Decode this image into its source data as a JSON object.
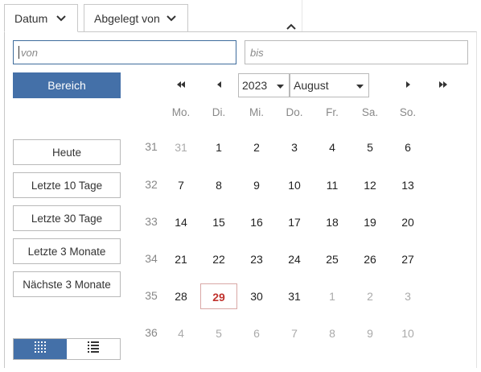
{
  "tabs": {
    "datum": "Datum",
    "abgelegt": "Abgelegt von"
  },
  "range": {
    "from_placeholder": "von",
    "to_placeholder": "bis"
  },
  "range_button": "Bereich",
  "quick": [
    "Heute",
    "Letzte 10 Tage",
    "Letzte 30 Tage",
    "Letzte 3 Monate",
    "Nächste 3 Monate"
  ],
  "calendar": {
    "year": "2023",
    "month": "August",
    "weekdays": [
      "Mo.",
      "Di.",
      "Mi.",
      "Do.",
      "Fr.",
      "Sa.",
      "So."
    ],
    "today": "29",
    "weeks": [
      {
        "kw": "31",
        "days": [
          [
            "31",
            true
          ],
          [
            "1",
            false
          ],
          [
            "2",
            false
          ],
          [
            "3",
            false
          ],
          [
            "4",
            false
          ],
          [
            "5",
            false
          ],
          [
            "6",
            false
          ]
        ]
      },
      {
        "kw": "32",
        "days": [
          [
            "7",
            false
          ],
          [
            "8",
            false
          ],
          [
            "9",
            false
          ],
          [
            "10",
            false
          ],
          [
            "11",
            false
          ],
          [
            "12",
            false
          ],
          [
            "13",
            false
          ]
        ]
      },
      {
        "kw": "33",
        "days": [
          [
            "14",
            false
          ],
          [
            "15",
            false
          ],
          [
            "16",
            false
          ],
          [
            "17",
            false
          ],
          [
            "18",
            false
          ],
          [
            "19",
            false
          ],
          [
            "20",
            false
          ]
        ]
      },
      {
        "kw": "34",
        "days": [
          [
            "21",
            false
          ],
          [
            "22",
            false
          ],
          [
            "23",
            false
          ],
          [
            "24",
            false
          ],
          [
            "25",
            false
          ],
          [
            "26",
            false
          ],
          [
            "27",
            false
          ]
        ]
      },
      {
        "kw": "35",
        "days": [
          [
            "28",
            false
          ],
          [
            "29",
            false
          ],
          [
            "30",
            false
          ],
          [
            "31",
            false
          ],
          [
            "1",
            true
          ],
          [
            "2",
            true
          ],
          [
            "3",
            true
          ]
        ]
      },
      {
        "kw": "36",
        "days": [
          [
            "4",
            true
          ],
          [
            "5",
            true
          ],
          [
            "6",
            true
          ],
          [
            "7",
            true
          ],
          [
            "8",
            true
          ],
          [
            "9",
            true
          ],
          [
            "10",
            true
          ]
        ]
      }
    ]
  },
  "colors": {
    "accent": "#4470a8",
    "today": "#c0322d"
  },
  "icons": {
    "first": "double-chevron-left-icon",
    "prev": "chevron-left-icon",
    "next": "chevron-right-icon",
    "last": "double-chevron-right-icon",
    "grid_view": "grid-icon",
    "list_view": "list-icon"
  }
}
